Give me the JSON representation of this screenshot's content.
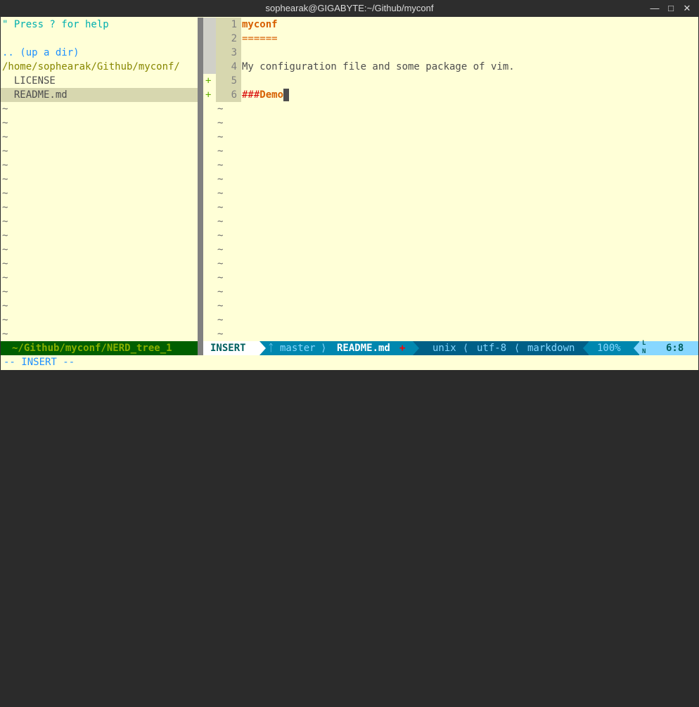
{
  "window": {
    "title": "sophearak@GIGABYTE:~/Github/myconf",
    "minimize_icon": "minimize-icon",
    "maximize_icon": "maximize-icon",
    "close_icon": "close-icon"
  },
  "nerdtree": {
    "help": "\" Press ? for help",
    "up_dir": ".. (up a dir)",
    "cwd": "/home/sophearak/Github/myconf/",
    "files": [
      "  LICENSE",
      "  README.md"
    ],
    "selected_index": 1,
    "filler": "~"
  },
  "editor": {
    "lines": [
      {
        "num": "1",
        "text": "myconf",
        "sign": ""
      },
      {
        "num": "2",
        "text": "======",
        "sign": ""
      },
      {
        "num": "3",
        "text": "",
        "sign": ""
      },
      {
        "num": "4",
        "text": "My configuration file and some package of vim.",
        "sign": ""
      },
      {
        "num": "5",
        "text": "",
        "sign": "+"
      },
      {
        "num": "6",
        "text": "###",
        "text2": "Demo",
        "sign": "+"
      }
    ],
    "cursor": "6:8",
    "filler": "~"
  },
  "statusline": {
    "nerd_path": "~/Github/myconf/NERD_tree_1",
    "mode": "INSERT",
    "branch_icon": "git-branch-icon",
    "branch": "master",
    "file": "README.md",
    "modified": "+",
    "fileformat": "unix",
    "encoding": "utf-8",
    "filetype": "markdown",
    "percent": "100%",
    "ln_icon": "LN",
    "position": "6:8"
  },
  "cmdline": "-- INSERT --",
  "colors": {
    "background": "#ffffd7",
    "nerd_status_bg": "#005f00",
    "mode_bg": "#ffffff",
    "branch_bg": "#0087af",
    "info_bg": "#005f87",
    "pos_bg": "#87d7ff",
    "heading": "#d75f00",
    "added_sign": "#5faf00"
  }
}
